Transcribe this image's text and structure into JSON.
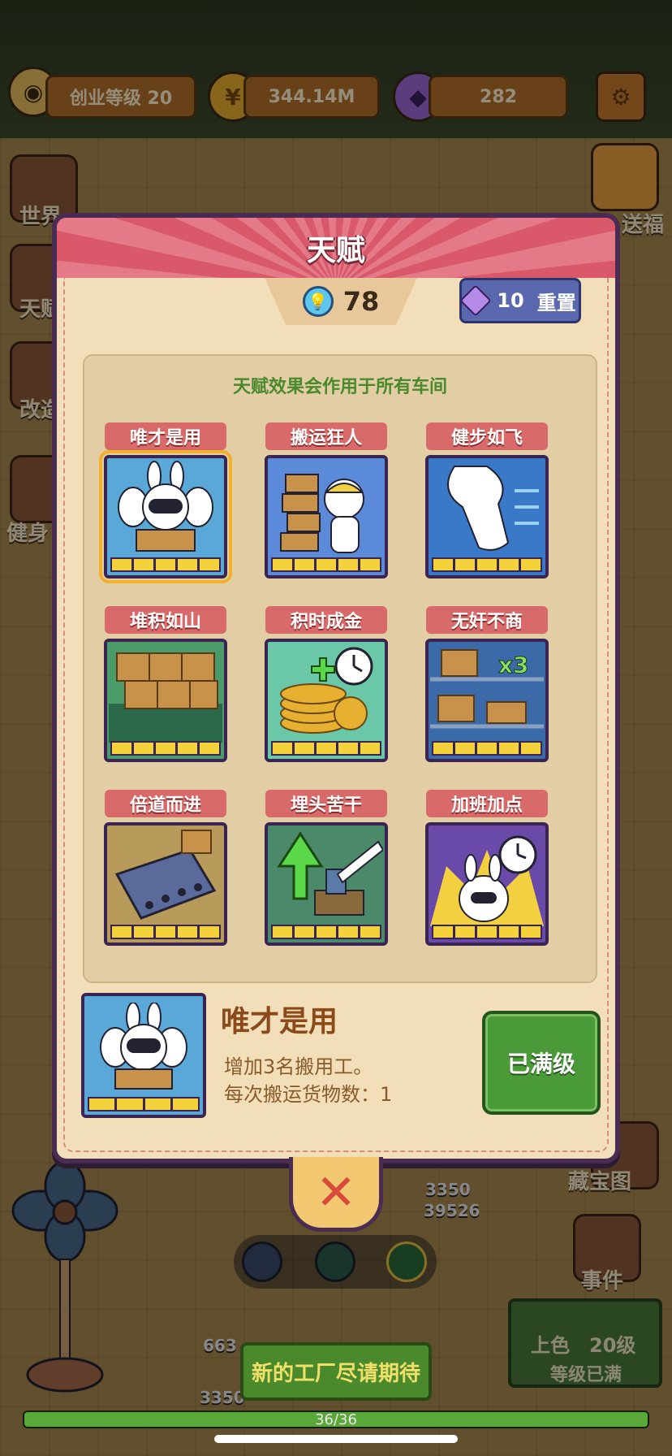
{
  "topbar": {
    "level_label": "创业等级 20",
    "coins": "344.14M",
    "gems": "282"
  },
  "side_menu": {
    "left": [
      "世界",
      "天赋",
      "改造",
      "健身"
    ],
    "right": [
      "送福",
      "藏宝图",
      "事件"
    ]
  },
  "modal": {
    "title": "天赋",
    "talent_points": "78",
    "reset_cost": "10",
    "reset_label": "重置",
    "note": "天赋效果会作用于所有车间"
  },
  "talents": [
    {
      "name": "唯才是用",
      "level": 5,
      "max": 5,
      "selected": true,
      "color": "#5aa8d8",
      "icon": "robot-rabbits-icon"
    },
    {
      "name": "搬运狂人",
      "level": 5,
      "max": 5,
      "selected": false,
      "color": "#5a8ad8",
      "icon": "boxes-rabbit-icon"
    },
    {
      "name": "健步如飞",
      "level": 5,
      "max": 5,
      "selected": false,
      "color": "#3a78c8",
      "icon": "running-leg-icon"
    },
    {
      "name": "堆积如山",
      "level": 5,
      "max": 5,
      "selected": false,
      "color": "#4a9a6a",
      "icon": "box-pile-icon"
    },
    {
      "name": "积时成金",
      "level": 5,
      "max": 5,
      "selected": false,
      "color": "#6ac8a8",
      "icon": "coin-clock-icon"
    },
    {
      "name": "无奸不商",
      "level": 5,
      "max": 5,
      "selected": false,
      "color": "#3a6aa8",
      "icon": "shelf-x3-icon"
    },
    {
      "name": "倍道而进",
      "level": 5,
      "max": 5,
      "selected": false,
      "color": "#b89a5a",
      "icon": "conveyor-icon"
    },
    {
      "name": "埋头苦干",
      "level": 5,
      "max": 5,
      "selected": false,
      "color": "#4a8a6a",
      "icon": "hammer-up-icon"
    },
    {
      "name": "加班加点",
      "level": 5,
      "max": 5,
      "selected": false,
      "color": "#6a4aa8",
      "icon": "overtime-clock-icon"
    }
  ],
  "detail": {
    "name": "唯才是用",
    "desc_line1": "增加3名搬用工。",
    "desc_line2": "每次搬运货物数：1",
    "button": "已满级",
    "level": 4,
    "max": 4
  },
  "scene": {
    "count_top": "3350",
    "count_bottom": "39526",
    "upgrade_label": "上色　20级",
    "upgrade_status": "等级已满",
    "num_a": "663",
    "num_b": "3350"
  },
  "bottom": {
    "banner": "新的工厂尽请期待",
    "progress_text": "36/36",
    "progress_value": 1.0
  },
  "colors": {
    "modal_bg": "#f2dfba",
    "header_red": "#d9596b",
    "frame_purple": "#4a2c52",
    "maxed_green": "#4a9a3a"
  }
}
